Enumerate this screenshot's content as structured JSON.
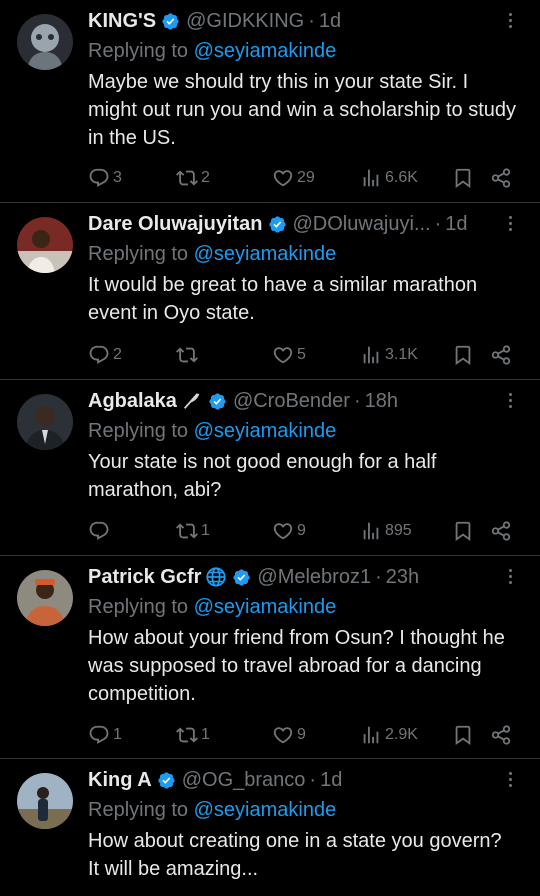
{
  "colors": {
    "background": "#000000",
    "text": "#e7e9ea",
    "muted": "#71767b",
    "accent": "#1d9bf0",
    "divider": "#2f3336"
  },
  "replying_prefix": "Replying to",
  "replies": [
    {
      "name": "KING'S",
      "handle": "@GIDKKING",
      "time": "1d",
      "mention": "@seyiamakinde",
      "text": "Maybe we should try this in your state Sir. I might out run you and win a scholarship to study in the US.",
      "replies_count": "3",
      "reposts_count": "2",
      "likes_count": "29",
      "views_count": "6.6K"
    },
    {
      "name": "Dare Oluwajuyitan",
      "handle": "@DOluwajuyi...",
      "time": "1d",
      "mention": "@seyiamakinde",
      "text": "It would be great to have a similar marathon event in Oyo state.",
      "replies_count": "2",
      "reposts_count": "",
      "likes_count": "5",
      "views_count": "3.1K"
    },
    {
      "name": "Agbalaka",
      "name_emoji": "feather-emoji",
      "handle": "@CroBender",
      "time": "18h",
      "mention": "@seyiamakinde",
      "text": "Your state is not good enough for a half marathon, abi?",
      "replies_count": "",
      "reposts_count": "1",
      "likes_count": "9",
      "views_count": "895"
    },
    {
      "name": "Patrick Gcfr",
      "name_emoji": "globe-emoji",
      "handle": "@Melebroz1",
      "time": "23h",
      "mention": "@seyiamakinde",
      "text": "How about your friend from Osun? I thought he was supposed to travel abroad for a dancing competition.",
      "replies_count": "1",
      "reposts_count": "1",
      "likes_count": "9",
      "views_count": "2.9K"
    },
    {
      "name": "King A",
      "handle": "@OG_branco",
      "time": "1d",
      "mention": "@seyiamakinde",
      "text": "How about creating one in a state you govern?  It will be amazing...",
      "replies_count": "",
      "reposts_count": "",
      "likes_count": "",
      "views_count": ""
    }
  ]
}
